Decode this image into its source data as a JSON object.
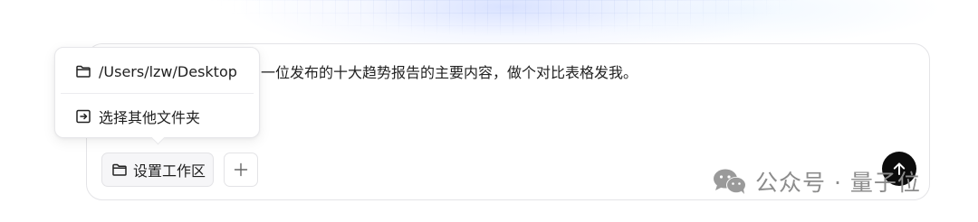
{
  "composer": {
    "prompt_text": "一位发布的十大趋势报告的主要内容，做个对比表格发我。",
    "workspace_button_label": "设置工作区"
  },
  "popover": {
    "items": [
      {
        "label": "/Users/lzw/Desktop",
        "icon": "folder-icon"
      },
      {
        "label": "选择其他文件夹",
        "icon": "folder-import-icon"
      }
    ]
  },
  "watermark": {
    "text": "公众号 · 量子位",
    "icon": "wechat-icon"
  },
  "icons": {
    "add": "plus-icon",
    "send": "arrow-up-icon"
  },
  "colors": {
    "send_button": "#0c0c0c",
    "border": "#e4e4e7",
    "watermark": "#8c8c8c"
  }
}
